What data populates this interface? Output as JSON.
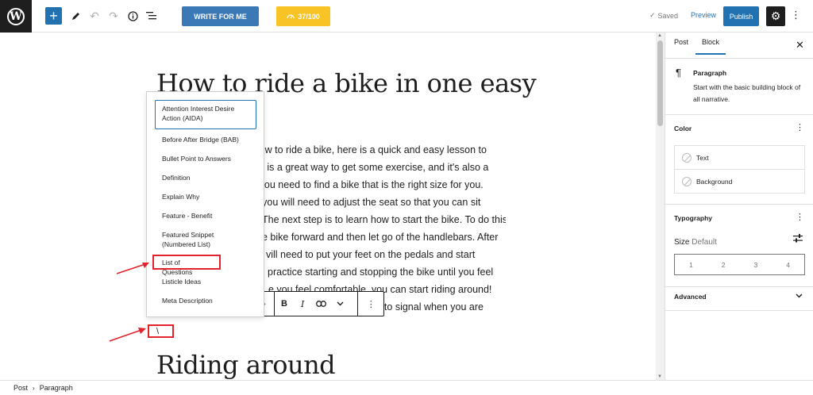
{
  "toolbar": {
    "write_label": "WRITE FOR ME",
    "score_label": "37/100",
    "saved_label": "Saved",
    "preview_label": "Preview",
    "publish_label": "Publish"
  },
  "editor": {
    "title": "How to ride a bike in one easy",
    "paragraph_lines": [
      "y how to ride a bike, here is a quick and easy lesson to",
      "iting is a great way to get some exercise, and it's also a",
      "st, you need to find a bike that is the right size for you.",
      "ke, you will need to adjust the seat so that you can sit",
      "The next step is to learn how to start the bike. To do this,",
      "e bike forward and then let go of the handlebars. After",
      "vill need to put your feet on the pedals and start",
      "practice starting and stopping the bike until you feel",
      "e you feel comfortable, you can start riding around!",
      "lookout for obstacles, and to signal when you are"
    ],
    "heading2": "Riding around",
    "slash_input": "\\"
  },
  "dropdown": {
    "items": [
      "Attention Interest Desire Action (AIDA)",
      "Before After Bridge (BAB)",
      "Bullet Point to Answers",
      "Definition",
      "Explain Why",
      "Feature - Benefit",
      "Featured Snippet (Numbered List)",
      "List of Questions",
      "Listicle Ideas",
      "Meta Description"
    ]
  },
  "block_toolbar": {
    "bold": "B",
    "italic": "I"
  },
  "sidebar": {
    "tab_post": "Post",
    "tab_block": "Block",
    "block_name": "Paragraph",
    "block_desc": "Start with the basic building block of all narrative.",
    "color_heading": "Color",
    "color_text": "Text",
    "color_background": "Background",
    "typography_heading": "Typography",
    "size_label": "Size",
    "size_value": "Default",
    "sizes": [
      "1",
      "2",
      "3",
      "4"
    ],
    "advanced_heading": "Advanced"
  },
  "footer": {
    "crumb_post": "Post",
    "crumb_paragraph": "Paragraph"
  },
  "colors": {
    "accent": "#2271b1",
    "annotation_red": "#e4222b",
    "score_yellow": "#f7c325"
  }
}
